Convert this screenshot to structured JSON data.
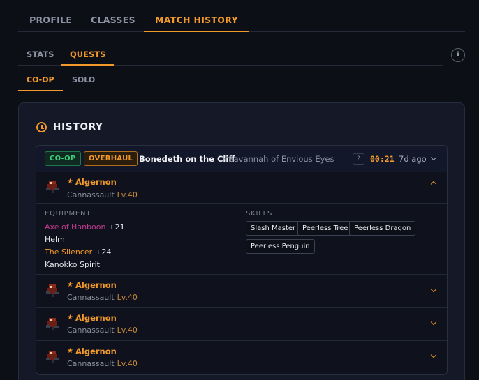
{
  "tabs": {
    "top": [
      {
        "label": "PROFILE"
      },
      {
        "label": "CLASSES"
      },
      {
        "label": "MATCH HISTORY"
      }
    ],
    "top_active": "MATCH HISTORY",
    "secondary": [
      {
        "label": "STATS"
      },
      {
        "label": "QUESTS"
      }
    ],
    "secondary_active": "QUESTS",
    "mode": [
      {
        "label": "CO-OP"
      },
      {
        "label": "SOLO"
      }
    ],
    "mode_active": "CO-OP",
    "info_icon": "i"
  },
  "history": {
    "title": "HISTORY",
    "icon": "clock-icon",
    "match": {
      "mode_badge": "CO-OP",
      "type_badge": "OVERHAUL",
      "name": "Bonedeth on the Cliff",
      "location": "· Savannah of Envious Eyes",
      "help": "?",
      "duration": "00:21",
      "ago": "7d ago",
      "players": [
        {
          "name": "Algernon",
          "class": "Cannassault",
          "level": "Lv.40",
          "expanded": true,
          "equipment_label": "EQUIPMENT",
          "skills_label": "SKILLS",
          "equipment": [
            {
              "name": "Axe of Hanboon",
              "bonus": "+21",
              "color": "#c0398e"
            },
            {
              "name": "Helm",
              "bonus": "",
              "color": "#e8eaf0"
            },
            {
              "name": "The Silencer",
              "bonus": "+24",
              "color": "#f39a2a"
            },
            {
              "name": "Kanokko Spirit",
              "bonus": "",
              "color": "#e8eaf0"
            }
          ],
          "skills": [
            "Slash Master",
            "Peerless Tree",
            "Peerless Dragon",
            "Peerless Penguin"
          ]
        },
        {
          "name": "Algernon",
          "class": "Cannassault",
          "level": "Lv.40",
          "expanded": false
        },
        {
          "name": "Algernon",
          "class": "Cannassault",
          "level": "Lv.40",
          "expanded": false
        },
        {
          "name": "Algernon",
          "class": "Cannassault",
          "level": "Lv.40",
          "expanded": false
        }
      ]
    }
  },
  "colors": {
    "accent": "#f39a2a",
    "coop_badge": "#3ecf7a",
    "background": "#0d0f17",
    "panel": "#141827"
  }
}
